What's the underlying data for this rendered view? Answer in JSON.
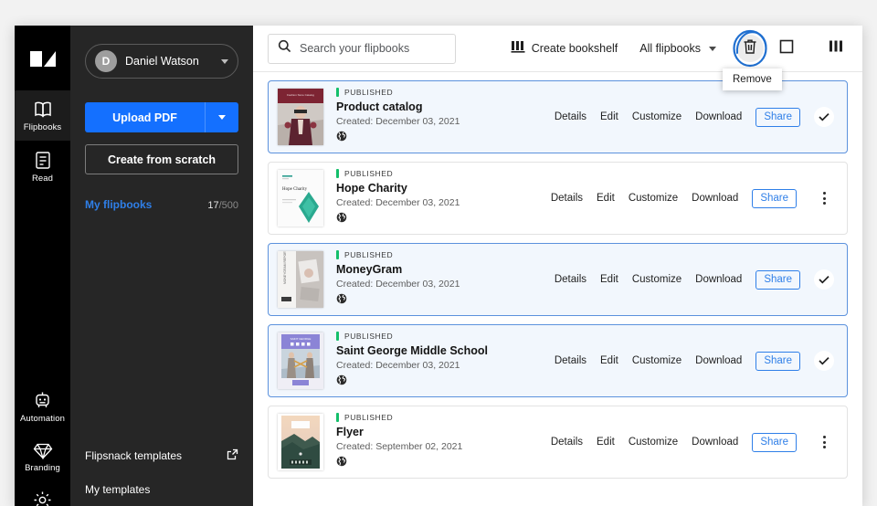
{
  "nav_rail": {
    "logo_icon": "flipbook-logo-icon",
    "items": [
      {
        "label": "Flipbooks",
        "icon": "open-book-icon",
        "active": true
      },
      {
        "label": "Read",
        "icon": "document-list-icon",
        "active": false
      },
      {
        "label": "Automation",
        "icon": "robot-icon",
        "active": false
      },
      {
        "label": "Branding",
        "icon": "diamond-icon",
        "active": false
      },
      {
        "label": "",
        "icon": "gear-icon",
        "active": false
      }
    ]
  },
  "sidebar": {
    "account": {
      "avatar_initial": "D",
      "name": "Daniel Watson",
      "caret_icon": "chevron-down-icon"
    },
    "upload_label": "Upload PDF",
    "upload_caret_icon": "chevron-down-icon",
    "scratch_label": "Create from scratch",
    "my_flipbooks_label": "My flipbooks",
    "quota_used": "17",
    "quota_total": "/500",
    "flipsnack_templates_label": "Flipsnack templates",
    "external_link_icon": "external-link-icon",
    "my_templates_label": "My templates"
  },
  "toolbar": {
    "search_icon": "search-icon",
    "search_value": "",
    "search_placeholder": "Search your flipbooks",
    "create_bookshelf_label": "Create bookshelf",
    "create_bookshelf_icon": "bookshelf-icon",
    "filter_label": "All flipbooks",
    "filter_caret_icon": "chevron-down-icon",
    "trash_icon": "trash-icon",
    "select_all_icon": "checkbox-empty-icon",
    "grid_view_icon": "grid-view-icon",
    "tooltip_text": "Remove"
  },
  "colors": {
    "accent_blue": "#1470ff",
    "link_blue": "#2f7fe8",
    "selected_border": "#5c92dd",
    "selected_bg": "#f2f7fd",
    "published_green": "#14bf6b",
    "annotation_blue": "#1f6fd0",
    "rail_black": "#000000",
    "sidebar_gray": "#262626"
  },
  "actions": {
    "details": "Details",
    "edit": "Edit",
    "customize": "Customize",
    "download": "Download",
    "share": "Share"
  },
  "list": {
    "status_label": "PUBLISHED",
    "date_prefix": "Created: ",
    "globe_icon": "globe-icon",
    "check_icon": "check-icon",
    "kebab_icon": "more-vertical-icon",
    "rows": [
      {
        "title": "Product catalog",
        "status": "PUBLISHED",
        "created": "Created: December 03, 2021",
        "selected": true,
        "thumb": "fashion-catalog-cover"
      },
      {
        "title": "Hope Charity",
        "status": "PUBLISHED",
        "created": "Created: December 03, 2021",
        "selected": false,
        "thumb": "charity-diamond-cover"
      },
      {
        "title": "MoneyGram",
        "status": "PUBLISHED",
        "created": "Created: December 03, 2021",
        "selected": true,
        "thumb": "moneygram-photo-cover"
      },
      {
        "title": "Saint George Middle School",
        "status": "PUBLISHED",
        "created": "Created: December 03, 2021",
        "selected": true,
        "thumb": "school-purple-cover"
      },
      {
        "title": "Flyer",
        "status": "PUBLISHED",
        "created": "Created: September 02, 2021",
        "selected": false,
        "thumb": "sunset-landscape-cover"
      }
    ]
  }
}
